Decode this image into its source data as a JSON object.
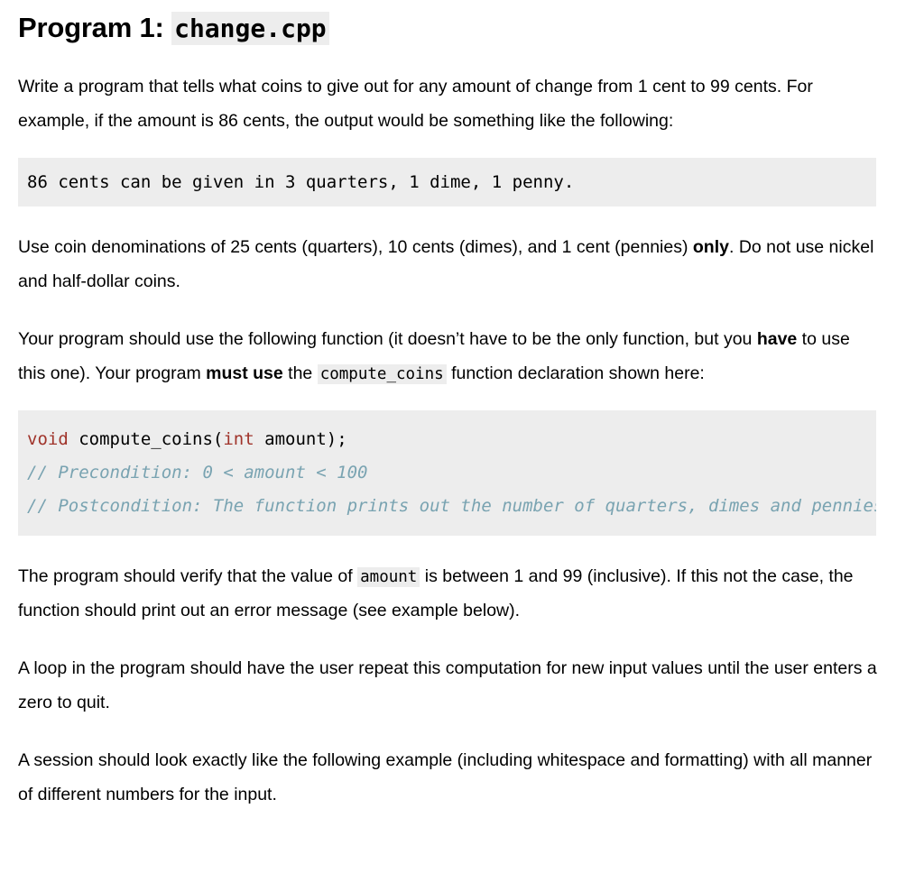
{
  "heading": {
    "prefix": "Program 1:",
    "filename": "change.cpp"
  },
  "paragraphs": {
    "intro_a": "Write a program that tells what coins to give out for any amount of change from 1 cent to 99 cents. For example, if the amount is 86 cents, the output would be something like the following:",
    "denominations_a": "Use coin denominations of 25 cents (quarters), 10 cents (dimes), and 1 cent (pennies) ",
    "denominations_bold": "only",
    "denominations_b": ". Do not use nickel and half-dollar coins.",
    "function_a": "Your program should use the following function (it doesn’t have to be the only function, but you ",
    "function_bold_1": "have",
    "function_b": " to use this one). Your program ",
    "function_bold_2": "must use",
    "function_c": " the ",
    "function_code": "compute_coins",
    "function_d": " function declaration shown here:",
    "verify_a": "The program should verify that the value of ",
    "verify_code": "amount",
    "verify_b": " is between 1 and 99 (inclusive). If this not the case, the function should print out an error message (see example below).",
    "loop": "A loop in the program should have the user repeat this computation for new input values until the user enters a zero to quit.",
    "session": "A session should look exactly like the following example (including whitespace and formatting) with all manner of different numbers for the input."
  },
  "output_example": {
    "text": "86 cents can be given in 3 quarters, 1 dime, 1 penny."
  },
  "function_declaration": {
    "line1_kw_void": "void",
    "line1_mid": " compute_coins(",
    "line1_kw_int": "int",
    "line1_end": " amount);",
    "line2_comment": "// Precondition: 0 < amount < 100",
    "line3_comment": "// Postcondition: The function prints out the number of quarters, dimes and pennies"
  },
  "colors": {
    "code_background": "#ededed",
    "keyword": "#a0342b",
    "comment": "#79a3b1",
    "text": "#000000",
    "page_background": "#ffffff"
  }
}
